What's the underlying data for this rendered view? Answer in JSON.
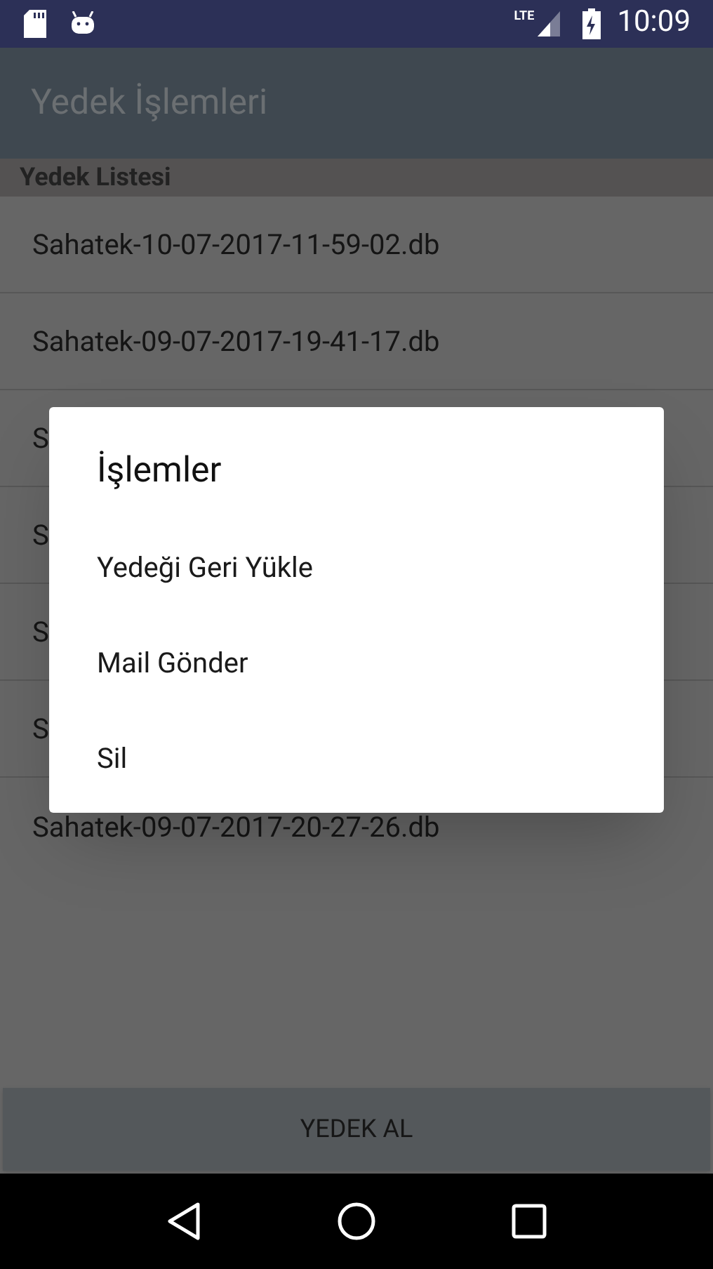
{
  "status_bar": {
    "time": "10:09",
    "network": "LTE"
  },
  "app_bar": {
    "title": "Yedek İşlemleri"
  },
  "section_header": "Yedek Listesi",
  "backups": [
    {
      "name": "Sahatek-10-07-2017-11-59-02.db"
    },
    {
      "name": "Sahatek-09-07-2017-19-41-17.db"
    },
    {
      "name": "S"
    },
    {
      "name": "S"
    },
    {
      "name": "S"
    },
    {
      "name": "S"
    },
    {
      "name": "Sahatek-09-07-2017-20-27-26.db"
    }
  ],
  "primary_button": "YEDEK AL",
  "dialog": {
    "title": "İşlemler",
    "options": [
      "Yedeği Geri Yükle",
      "Mail Gönder",
      "Sil"
    ]
  }
}
